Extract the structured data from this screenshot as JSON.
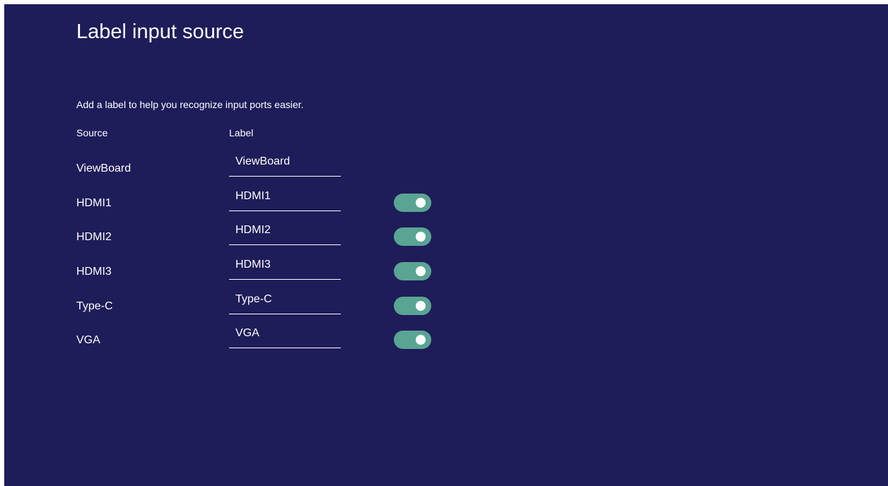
{
  "page": {
    "title": "Label input source",
    "description": "Add a label to help you recognize input ports easier."
  },
  "table": {
    "headers": {
      "source": "Source",
      "label": "Label"
    },
    "rows": [
      {
        "source": "ViewBoard",
        "label": "ViewBoard",
        "has_toggle": false
      },
      {
        "source": "HDMI1",
        "label": "HDMI1",
        "has_toggle": true,
        "toggle_on": true
      },
      {
        "source": "HDMI2",
        "label": "HDMI2",
        "has_toggle": true,
        "toggle_on": true
      },
      {
        "source": "HDMI3",
        "label": "HDMI3",
        "has_toggle": true,
        "toggle_on": true
      },
      {
        "source": "Type-C",
        "label": "Type-C",
        "has_toggle": true,
        "toggle_on": true
      },
      {
        "source": "VGA",
        "label": "VGA",
        "has_toggle": true,
        "toggle_on": true
      }
    ]
  },
  "colors": {
    "background": "#1f1c5a",
    "toggle_on": "#5aa493",
    "text": "#ffffff"
  }
}
